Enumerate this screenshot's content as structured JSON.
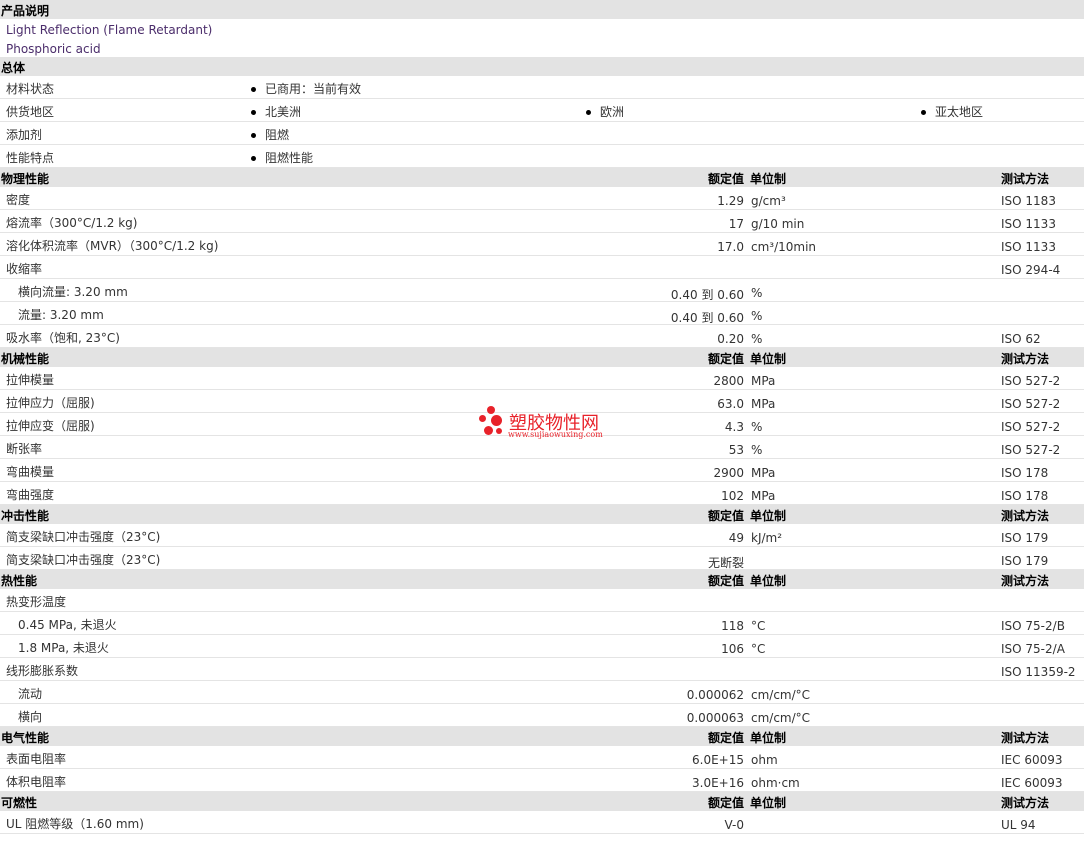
{
  "description": {
    "title": "产品说明",
    "lines": [
      "Light Reflection (Flame Retardant)",
      "Phosphoric acid"
    ]
  },
  "general": {
    "title": "总体",
    "rows": [
      {
        "label": "材料状态",
        "items": [
          "已商用：当前有效"
        ]
      },
      {
        "label": "供货地区",
        "items": [
          "北美洲",
          "欧洲",
          "亚太地区"
        ]
      },
      {
        "label": "添加剂",
        "items": [
          "阻燃"
        ]
      },
      {
        "label": "性能特点",
        "items": [
          "阻燃性能"
        ]
      }
    ]
  },
  "headers": {
    "nominal": "额定值",
    "unit": "单位制",
    "method": "测试方法"
  },
  "physical": {
    "title": "物理性能",
    "rows": [
      {
        "label": "密度",
        "value": "1.29",
        "unit": "g/cm³",
        "method": "ISO 1183"
      },
      {
        "label": "熔流率（300°C/1.2 kg)",
        "value": "17",
        "unit": "g/10 min",
        "method": "ISO 1133"
      },
      {
        "label": "溶化体积流率（MVR）（300°C/1.2 kg)",
        "value": "17.0",
        "unit": "cm³/10min",
        "method": "ISO 1133"
      },
      {
        "label": "收缩率",
        "value": "",
        "unit": "",
        "method": "ISO 294-4"
      },
      {
        "label": "横向流量: 3.20 mm",
        "value": "0.40 到  0.60",
        "unit": "%",
        "method": "",
        "sub": true
      },
      {
        "label": "流量: 3.20 mm",
        "value": "0.40 到  0.60",
        "unit": "%",
        "method": "",
        "sub": true
      },
      {
        "label": "吸水率（饱和, 23°C)",
        "value": "0.20",
        "unit": "%",
        "method": "ISO 62"
      }
    ]
  },
  "mechanical": {
    "title": "机械性能",
    "rows": [
      {
        "label": "拉伸模量",
        "value": "2800",
        "unit": "MPa",
        "method": "ISO 527-2"
      },
      {
        "label": "拉伸应力（屈服)",
        "value": "63.0",
        "unit": "MPa",
        "method": "ISO 527-2"
      },
      {
        "label": "拉伸应变（屈服)",
        "value": "4.3",
        "unit": "%",
        "method": "ISO 527-2"
      },
      {
        "label": "断张率",
        "value": "53",
        "unit": "%",
        "method": "ISO 527-2"
      },
      {
        "label": "弯曲模量",
        "value": "2900",
        "unit": "MPa",
        "method": "ISO 178"
      },
      {
        "label": "弯曲强度",
        "value": "102",
        "unit": "MPa",
        "method": "ISO 178"
      }
    ]
  },
  "impact": {
    "title": "冲击性能",
    "rows": [
      {
        "label": "简支梁缺口冲击强度（23°C)",
        "value": "49",
        "unit": "kJ/m²",
        "method": "ISO 179"
      },
      {
        "label": "简支梁缺口冲击强度（23°C)",
        "value": "无断裂",
        "unit": "",
        "method": "ISO 179"
      }
    ]
  },
  "thermal": {
    "title": "热性能",
    "rows": [
      {
        "label": "热变形温度",
        "value": "",
        "unit": "",
        "method": ""
      },
      {
        "label": "0.45 MPa, 未退火",
        "value": "118",
        "unit": "°C",
        "method": "ISO 75-2/B",
        "sub": true
      },
      {
        "label": "1.8 MPa, 未退火",
        "value": "106",
        "unit": "°C",
        "method": "ISO 75-2/A",
        "sub": true
      },
      {
        "label": "线形膨胀系数",
        "value": "",
        "unit": "",
        "method": "ISO 11359-2"
      },
      {
        "label": "流动",
        "value": "0.000062",
        "unit": "cm/cm/°C",
        "method": "",
        "sub": true
      },
      {
        "label": "横向",
        "value": "0.000063",
        "unit": "cm/cm/°C",
        "method": "",
        "sub": true
      }
    ]
  },
  "electrical": {
    "title": "电气性能",
    "rows": [
      {
        "label": "表面电阻率",
        "value": "6.0E+15",
        "unit": "ohm",
        "method": "IEC 60093"
      },
      {
        "label": "体积电阻率",
        "value": "3.0E+16",
        "unit": "ohm·cm",
        "method": "IEC 60093"
      }
    ]
  },
  "flammability": {
    "title": "可燃性",
    "rows": [
      {
        "label": "UL 阻燃等级（1.60 mm)",
        "value": "V-0",
        "unit": "",
        "method": "UL 94"
      }
    ]
  },
  "watermark": {
    "name": "塑胶物性网",
    "url": "www.sujiaowuxing.com"
  },
  "colors": {
    "header_bg": "#e3e3e3",
    "desc_text": "#4b2d6b",
    "watermark": "#e8222a"
  }
}
